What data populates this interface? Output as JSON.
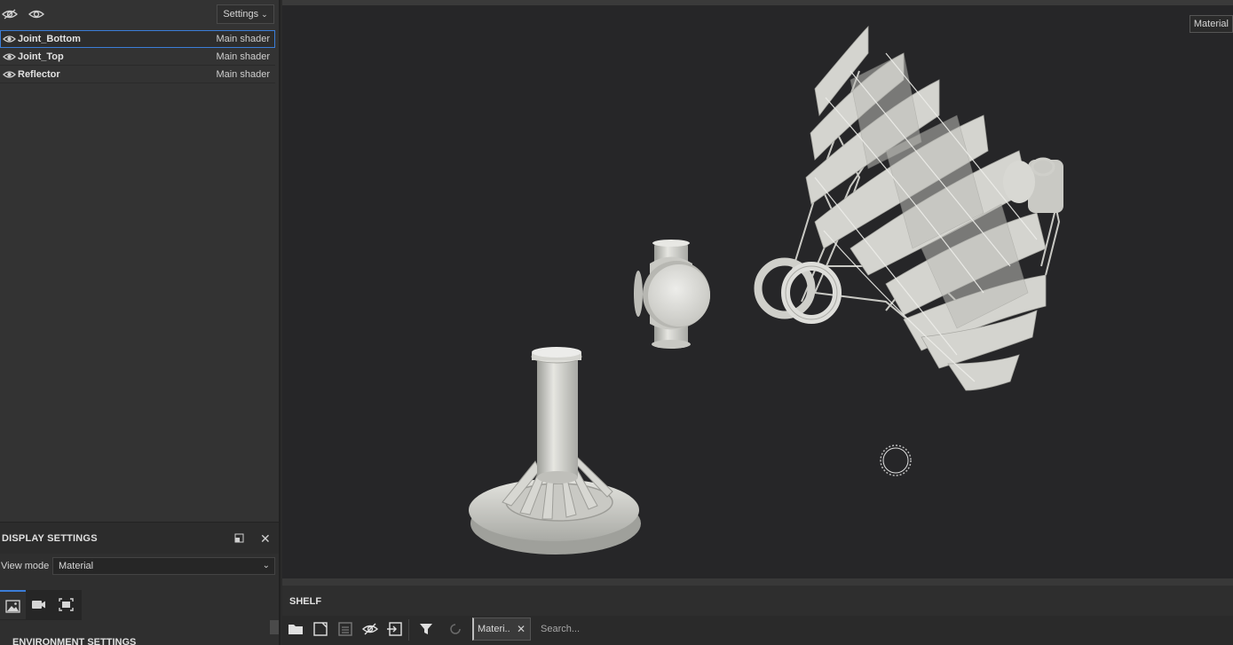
{
  "left_panel": {
    "settings_label": "Settings",
    "texture_sets": [
      {
        "name": "Joint_Bottom",
        "shader": "Main shader",
        "selected": true
      },
      {
        "name": "Joint_Top",
        "shader": "Main shader",
        "selected": false
      },
      {
        "name": "Reflector",
        "shader": "Main shader",
        "selected": false
      }
    ]
  },
  "display_settings": {
    "title": "DISPLAY SETTINGS",
    "view_mode_label": "View mode",
    "view_mode_value": "Material",
    "tabs": [
      "environment-tab-icon",
      "camera-tab-icon",
      "viewer-tab-icon"
    ],
    "environment_title": "ENVIRONMENT SETTINGS"
  },
  "viewport": {
    "mode_badge": "Material",
    "accent_color": "#3b7dd8"
  },
  "shelf": {
    "title": "SHELF",
    "filter_chip": "Materi..",
    "search_placeholder": "Search..."
  }
}
